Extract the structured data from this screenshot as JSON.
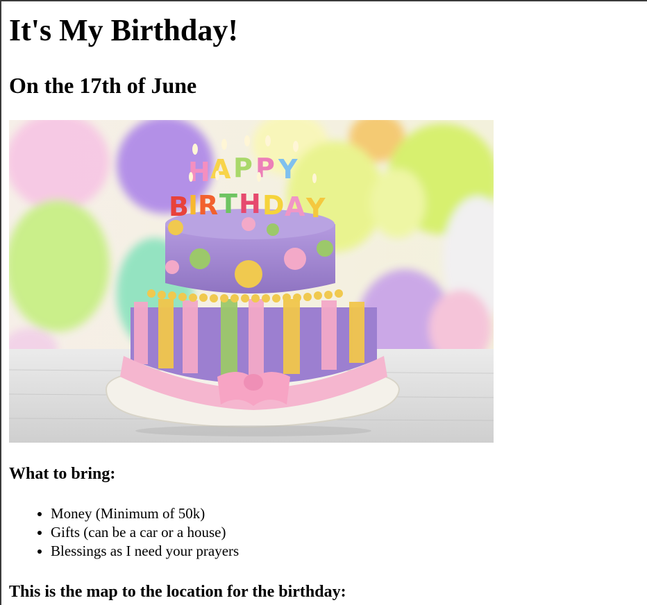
{
  "page": {
    "title": "It's My Birthday!",
    "subtitle": "On the 17th of June",
    "image_description": "birthday-cake-image",
    "bring_heading": "What to bring:",
    "bring_items": [
      "Money (Minimum of 50k)",
      "Gifts (can be a car or a house)",
      "Blessings as I need your prayers"
    ],
    "map_heading": "This is the map to the location for the birthday:"
  },
  "colors": {
    "text": "#000000",
    "background": "#ffffff",
    "cake_purple": "#9a7fc8",
    "cake_pink": "#f3a9c8",
    "cake_yellow": "#f1c64c",
    "cake_green": "#9cc86a",
    "balloon_lime": "#d6f06a"
  }
}
